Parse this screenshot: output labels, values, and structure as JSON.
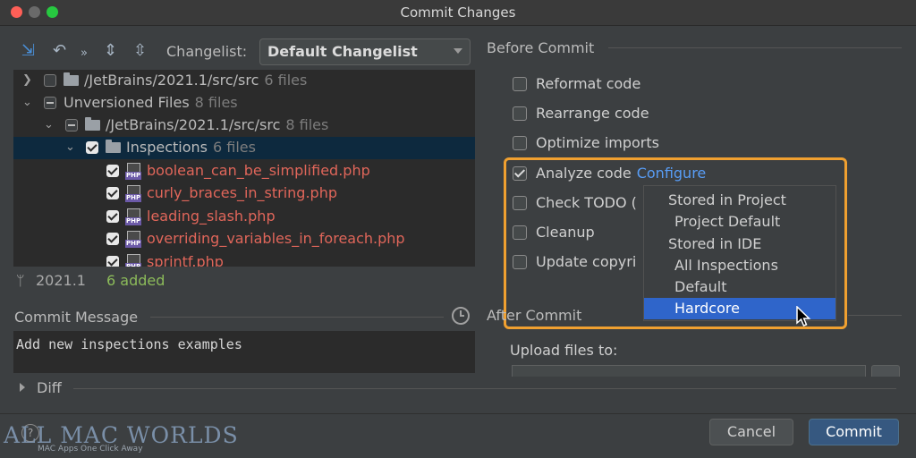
{
  "window": {
    "title": "Commit Changes"
  },
  "toolbar": {
    "changelist_label": "Changelist:",
    "changelist_value": "Default Changelist"
  },
  "tree": {
    "rows": [
      {
        "text": "/JetBrains/2021.1/src/src",
        "count": "6 files"
      },
      {
        "text": "Unversioned Files",
        "count": "8 files"
      },
      {
        "text": "/JetBrains/2021.1/src/src",
        "count": "8 files"
      },
      {
        "text": "Inspections",
        "count": "6 files"
      },
      {
        "text": "boolean_can_be_simplified.php"
      },
      {
        "text": "curly_braces_in_string.php"
      },
      {
        "text": "leading_slash.php"
      },
      {
        "text": "overriding_variables_in_foreach.php"
      },
      {
        "text": "sprintf.php"
      }
    ]
  },
  "status": {
    "branch": "2021.1",
    "added": "6 added"
  },
  "commit_message": {
    "label": "Commit Message",
    "text": "Add new inspections examples"
  },
  "diff": {
    "label": "Diff"
  },
  "before_commit": {
    "title": "Before Commit",
    "options": [
      {
        "label": "Reformat code",
        "checked": false
      },
      {
        "label": "Rearrange code",
        "checked": false
      },
      {
        "label": "Optimize imports",
        "checked": false
      },
      {
        "label": "Analyze code",
        "checked": true,
        "link": "Configure"
      },
      {
        "label": "Check TODO (",
        "checked": false
      },
      {
        "label": "Cleanup",
        "checked": false
      },
      {
        "label": "Update copyri",
        "checked": false
      }
    ]
  },
  "menu": {
    "items": [
      "Stored in Project",
      "Project Default",
      "Stored in IDE",
      "All Inspections",
      "Default",
      "Hardcore"
    ],
    "selected": "Hardcore"
  },
  "after_commit": {
    "title": "After Commit",
    "upload_label": "Upload files to:"
  },
  "buttons": {
    "cancel": "Cancel",
    "commit": "Commit",
    "help": "?"
  },
  "watermark": {
    "text": "ALL MAC WORLDS",
    "sub": "MAC Apps One Click Away"
  },
  "colors": {
    "accent": "#2f65ca",
    "highlight": "#f0a030",
    "unversioned": "#e0665a",
    "added": "#8cbb5a",
    "link": "#589df6"
  }
}
